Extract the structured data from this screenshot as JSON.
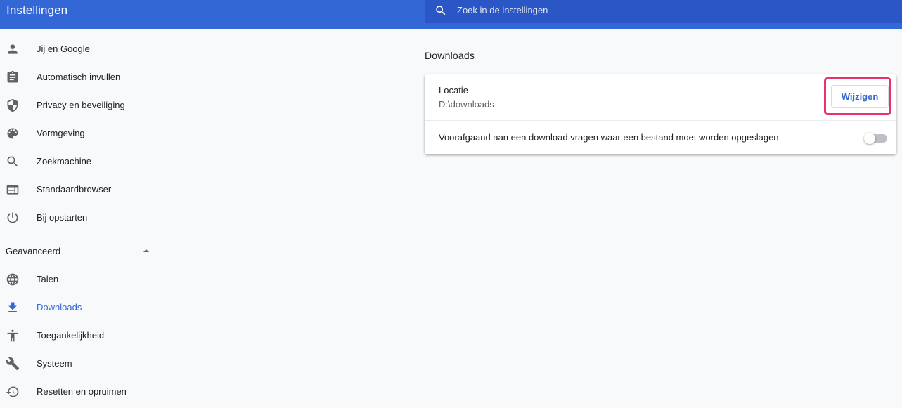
{
  "header": {
    "title": "Instellingen",
    "search_placeholder": "Zoek in de instellingen"
  },
  "sidebar": {
    "items": [
      {
        "label": "Jij en Google",
        "icon": "person-icon"
      },
      {
        "label": "Automatisch invullen",
        "icon": "clipboard-icon"
      },
      {
        "label": "Privacy en beveiliging",
        "icon": "shield-icon"
      },
      {
        "label": "Vormgeving",
        "icon": "palette-icon"
      },
      {
        "label": "Zoekmachine",
        "icon": "search-icon"
      },
      {
        "label": "Standaardbrowser",
        "icon": "browser-icon"
      },
      {
        "label": "Bij opstarten",
        "icon": "power-icon"
      }
    ],
    "advanced_label": "Geavanceerd",
    "advanced_items": [
      {
        "label": "Talen",
        "icon": "globe-icon"
      },
      {
        "label": "Downloads",
        "icon": "download-icon",
        "active": true
      },
      {
        "label": "Toegankelijkheid",
        "icon": "accessibility-icon"
      },
      {
        "label": "Systeem",
        "icon": "wrench-icon"
      },
      {
        "label": "Resetten en opruimen",
        "icon": "restore-icon"
      }
    ]
  },
  "main": {
    "section_title": "Downloads",
    "location_label": "Locatie",
    "location_value": "D:\\downloads",
    "change_button": "Wijzigen",
    "ask_label": "Voorafgaand aan een download vragen waar een bestand moet worden opgeslagen",
    "ask_enabled": false
  },
  "colors": {
    "header": "#3367d6",
    "search_bg": "#2a56c6",
    "accent": "#3367d6",
    "highlight": "#e8336a",
    "background": "#f8f9fa"
  }
}
